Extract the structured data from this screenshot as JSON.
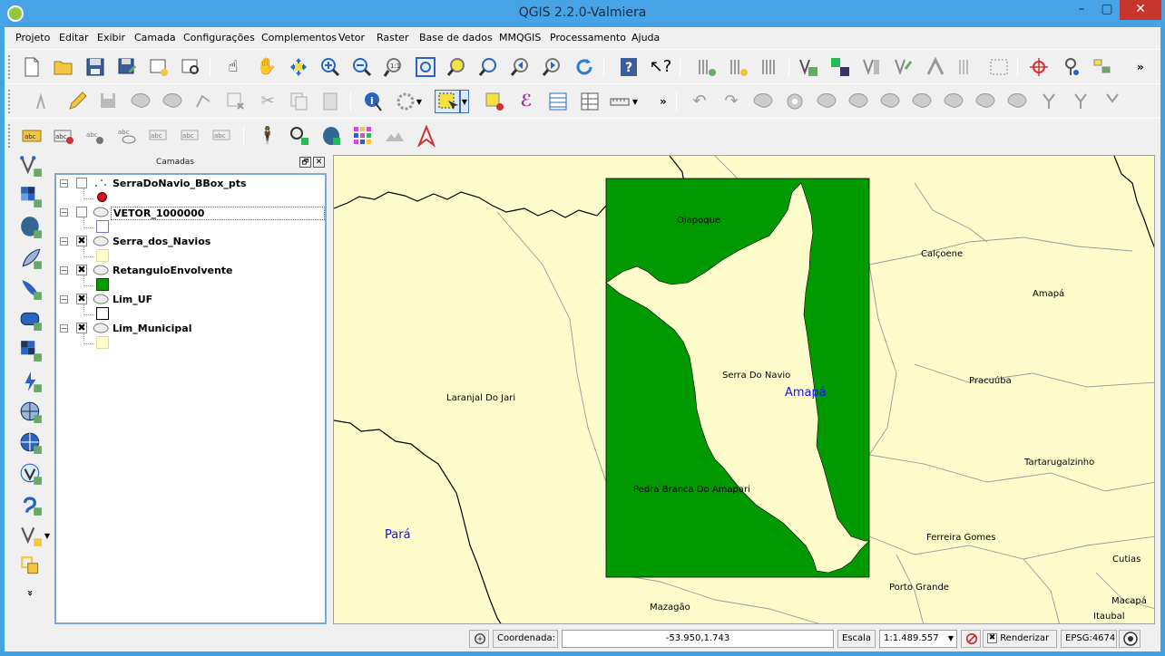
{
  "window": {
    "title": "QGIS 2.2.0-Valmiera",
    "minimize": "–",
    "maximize": "▢",
    "close": "✕"
  },
  "menu": [
    "Projeto",
    "Editar",
    "Exibir",
    "Camada",
    "Configurações",
    "Complementos",
    "Vetor",
    "Raster",
    "Base de dados",
    "MMQGIS",
    "Processamento",
    "Ajuda"
  ],
  "toolbar_more": "»",
  "layers_panel": {
    "title": "Camadas",
    "float": "🗗",
    "close": "✕",
    "layers": [
      {
        "name": "SerraDoNavio_BBox_pts",
        "checked": false,
        "symbol": "point",
        "color": "#d2141a",
        "expander": "−"
      },
      {
        "name": "VETOR_1000000",
        "checked": false,
        "symbol": "polygon",
        "color": "#ffffff",
        "expander": "−",
        "selected": true
      },
      {
        "name": "Serra_dos_Navios",
        "checked": true,
        "symbol": "polygon",
        "color": "#fffccc",
        "expander": "−"
      },
      {
        "name": "RetanguloEnvolvente",
        "checked": true,
        "symbol": "polygon",
        "color": "#00a000",
        "expander": "−"
      },
      {
        "name": "Lim_UF",
        "checked": true,
        "symbol": "polygon",
        "color": "#ffffff",
        "expander": "−"
      },
      {
        "name": "Lim_Municipal",
        "checked": true,
        "symbol": "polygon",
        "color": "#fffccc",
        "expander": "−"
      }
    ],
    "check_mark": "✖"
  },
  "map": {
    "background": "#fffccc",
    "rect_color": "#009900",
    "labels": {
      "oiapoque": "Oiapoque",
      "calcoene": "Calçoene",
      "amapa_city": "Amapá",
      "amapa_state": "Amapá",
      "serra_do_navio": "Serra Do Navio",
      "pracuuba": "Pracuúba",
      "laranjal": "Laranjal Do Jari",
      "tartarugalzinho": "Tartarugalzinho",
      "pedra_branca": "Pedra Branca Do Amapari",
      "para": "Pará",
      "ferreira_gomes": "Ferreira Gomes",
      "cutias": "Cutias",
      "porto_grande": "Porto Grande",
      "mazagao": "Mazagão",
      "macapa": "Macapá",
      "itaubal": "Itaubal"
    }
  },
  "statusbar": {
    "coord_label": "Coordenada:",
    "coord_value": "-53.950,1.743",
    "scale_label": "Escala",
    "scale_value": "1:1.489.557",
    "render_label": "Renderizar",
    "render_checked": "✖",
    "crs": "EPSG:4674",
    "dropdown_arrow": "▼"
  }
}
